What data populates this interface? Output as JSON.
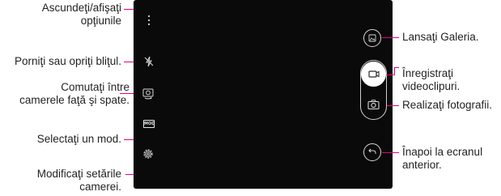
{
  "callouts": {
    "hide_show_options": [
      "Ascundeţi/afişaţi",
      "opţiunile"
    ],
    "flash_toggle": [
      "Porniţi sau opriţi bliţul."
    ],
    "switch_cameras": [
      "Comutaţi între",
      "camerele faţă şi spate."
    ],
    "select_mode": [
      "Selectaţi un mod."
    ],
    "change_settings": [
      "Modificaţi setările",
      "camerei."
    ],
    "launch_gallery": [
      "Lansaţi Galeria."
    ],
    "record_video": [
      "Înregistraţi",
      "videoclipuri."
    ],
    "take_photo": [
      "Realizaţi fotografii."
    ],
    "back_previous": [
      "Înapoi la ecranul",
      "anterior."
    ]
  },
  "screen": {
    "mode_icon_text": "MOD"
  },
  "colors": {
    "leader": "#e6007e",
    "screen_bg": "#0a0a0a",
    "icon": "#d8d8d8"
  },
  "icons": {
    "options": "three-dots-vertical-icon",
    "flash": "flash-off-icon",
    "switch": "switch-camera-icon",
    "mode": "mode-icon",
    "settings": "gear-icon",
    "gallery": "gallery-icon",
    "video": "video-camera-icon",
    "photo": "camera-icon",
    "back": "back-arrow-icon"
  }
}
